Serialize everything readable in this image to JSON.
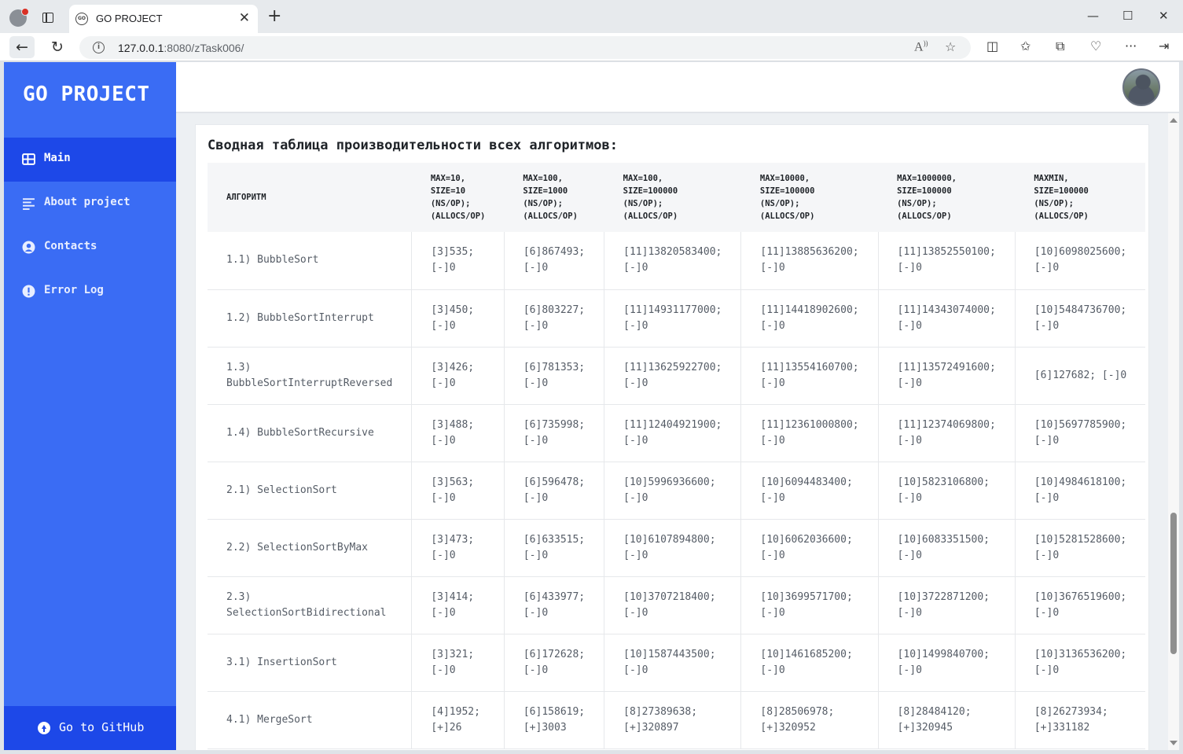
{
  "browser": {
    "tab_title": "GO PROJECT",
    "favicon_text": "GO",
    "url_host": "127.0.0.1",
    "url_path": ":8080/zTask006/"
  },
  "sidebar": {
    "brand": "GO PROJECT",
    "items": [
      {
        "label": "Main",
        "icon": "table-icon",
        "active": true
      },
      {
        "label": "About project",
        "icon": "align-left-icon",
        "active": false
      },
      {
        "label": "Contacts",
        "icon": "user-circle-icon",
        "active": false
      },
      {
        "label": "Error Log",
        "icon": "alert-circle-icon",
        "active": false
      }
    ],
    "github_label": "Go to GitHub"
  },
  "main": {
    "title": "Сводная таблица производительности всех алгоритмов:",
    "table": {
      "columns": [
        "АЛГОРИТМ",
        "MAX=10,\nSIZE=10\n(NS/OP);\n(ALLOCS/OP)",
        "MAX=100,\nSIZE=1000\n(NS/OP);\n(ALLOCS/OP)",
        "MAX=100,\nSIZE=100000\n(NS/OP);\n(ALLOCS/OP)",
        "MAX=10000,\nSIZE=100000\n(NS/OP);\n(ALLOCS/OP)",
        "MAX=1000000,\nSIZE=100000\n(NS/OP);\n(ALLOCS/OP)",
        "MAXMIN,\nSIZE=100000\n(NS/OP);\n(ALLOCS/OP)"
      ],
      "rows": [
        [
          "1.1) BubbleSort",
          "[3]535; [-]0",
          "[6]867493; [-]0",
          "[11]13820583400; [-]0",
          "[11]13885636200; [-]0",
          "[11]13852550100; [-]0",
          "[10]6098025600; [-]0"
        ],
        [
          "1.2) BubbleSortInterrupt",
          "[3]450; [-]0",
          "[6]803227; [-]0",
          "[11]14931177000; [-]0",
          "[11]14418902600; [-]0",
          "[11]14343074000; [-]0",
          "[10]5484736700; [-]0"
        ],
        [
          "1.3) BubbleSortInterruptReversed",
          "[3]426; [-]0",
          "[6]781353; [-]0",
          "[11]13625922700; [-]0",
          "[11]13554160700; [-]0",
          "[11]13572491600; [-]0",
          "[6]127682; [-]0"
        ],
        [
          "1.4) BubbleSortRecursive",
          "[3]488; [-]0",
          "[6]735998; [-]0",
          "[11]12404921900; [-]0",
          "[11]12361000800; [-]0",
          "[11]12374069800; [-]0",
          "[10]5697785900; [-]0"
        ],
        [
          "2.1) SelectionSort",
          "[3]563; [-]0",
          "[6]596478; [-]0",
          "[10]5996936600; [-]0",
          "[10]6094483400; [-]0",
          "[10]5823106800; [-]0",
          "[10]4984618100; [-]0"
        ],
        [
          "2.2) SelectionSortByMax",
          "[3]473; [-]0",
          "[6]633515; [-]0",
          "[10]6107894800; [-]0",
          "[10]6062036600; [-]0",
          "[10]6083351500; [-]0",
          "[10]5281528600; [-]0"
        ],
        [
          "2.3) SelectionSortBidirectional",
          "[3]414; [-]0",
          "[6]433977; [-]0",
          "[10]3707218400; [-]0",
          "[10]3699571700; [-]0",
          "[10]3722871200; [-]0",
          "[10]3676519600; [-]0"
        ],
        [
          "3.1) InsertionSort",
          "[3]321; [-]0",
          "[6]172628; [-]0",
          "[10]1587443500; [-]0",
          "[10]1461685200; [-]0",
          "[10]1499840700; [-]0",
          "[10]3136536200; [-]0"
        ],
        [
          "4.1) MergeSort",
          "[4]1952; [+]26",
          "[6]158619; [+]3003",
          "[8]27389638; [+]320897",
          "[8]28506978; [+]320952",
          "[8]28484120; [+]320945",
          "[8]26273934; [+]331182"
        ]
      ]
    }
  }
}
